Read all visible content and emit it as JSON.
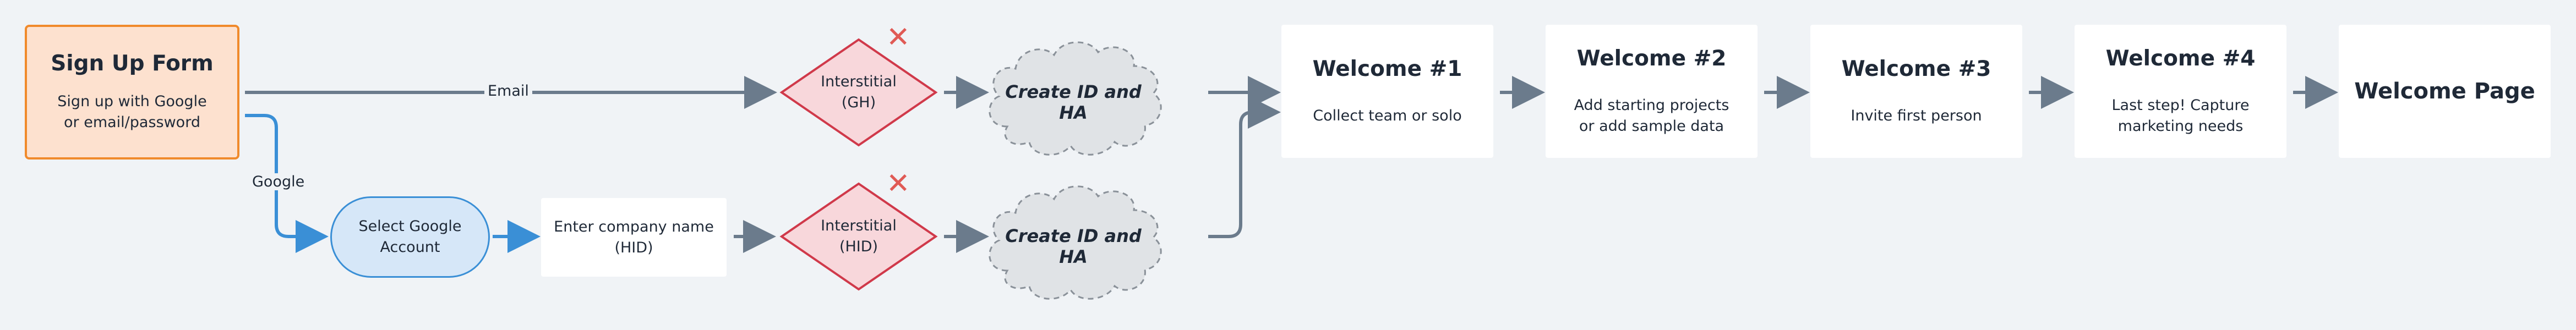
{
  "start": {
    "title": "Sign Up Form",
    "subtitle_line1": "Sign up with Google",
    "subtitle_line2": "or email/password"
  },
  "edges": {
    "email_label": "Email",
    "google_label": "Google"
  },
  "google_account": {
    "line1": "Select Google",
    "line2": "Account"
  },
  "company": {
    "line1": "Enter company name",
    "line2": "(HID)"
  },
  "interstitial_gh": {
    "line1": "Interstitial",
    "line2": "(GH)"
  },
  "interstitial_hid": {
    "line1": "Interstitial",
    "line2": "(HID)"
  },
  "cloud_top": {
    "label": "Create ID and HA"
  },
  "cloud_bottom": {
    "label": "Create ID and HA"
  },
  "welcome1": {
    "title": "Welcome #1",
    "line1": "Collect team or solo"
  },
  "welcome2": {
    "title": "Welcome #2",
    "line1": "Add starting projects",
    "line2": "or add sample data"
  },
  "welcome3": {
    "title": "Welcome #3",
    "line1": "Invite first person"
  },
  "welcome4": {
    "title": "Welcome #4",
    "line1": "Last step! Capture",
    "line2": "marketing needs"
  },
  "welcome_page": {
    "title": "Welcome Page"
  },
  "icons": {
    "deprecated": "close-x-icon"
  },
  "colors": {
    "start_fill": "#fde1cf",
    "start_border": "#f08a2c",
    "google_blue": "#3a8fd6",
    "diamond_fill": "#f8d7db",
    "diamond_border": "#d0394a",
    "cloud_fill": "#e0e3e6",
    "arrow_gray": "#6b7b8c",
    "x_red": "#e05a55"
  }
}
